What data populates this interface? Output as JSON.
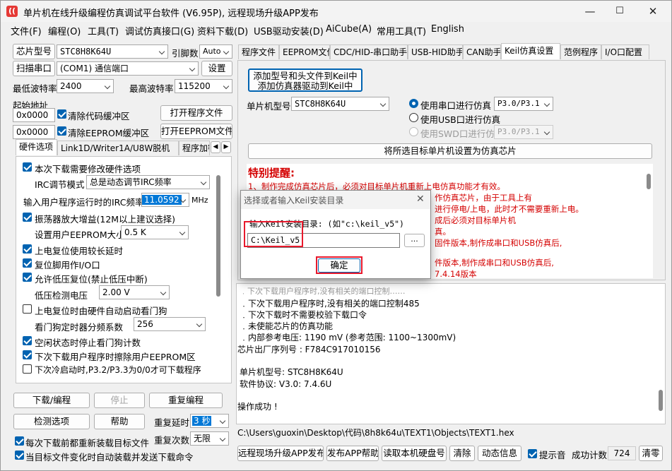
{
  "window": {
    "title": "单片机在线升级编程仿真调试平台软件 (V6.95P), 远程现场升级APP发布",
    "min": "—",
    "max": "☐",
    "close": "✕",
    "app_icon": "signal-icon"
  },
  "menu": [
    "文件(F)",
    "编程(O)",
    "工具(T)",
    "调试仿真接口(G)",
    "资料下载(D)",
    "USB驱动安装(D)",
    "AiCube(A)",
    "常用工具(T)",
    "English"
  ],
  "left": {
    "chip_model_btn": "芯片型号",
    "chip_model": "STC8H8K64U",
    "pin_label": "引脚数",
    "pin_value": "Auto",
    "scan_btn": "扫描串口",
    "port": "(COM1) 通信端口",
    "settings_btn": "设置",
    "min_baud_label": "最低波特率",
    "min_baud": "2400",
    "max_baud_label": "最高波特率",
    "max_baud": "115200",
    "start_addr_label": "起始地址",
    "addr1": "0x0000",
    "clear_code": "清除代码缓冲区",
    "open_prog": "打开程序文件",
    "addr2": "0x0000",
    "clear_eeprom": "清除EEPROM缓冲区",
    "open_eeprom": "打开EEPROM文件",
    "tabs": [
      "硬件选项",
      "Link1D/Writer1A/U8W脱机",
      "程序加密后"
    ],
    "opt_update_hw": "本次下载需要修改硬件选项",
    "irc_mode_label": "IRC调节模式",
    "irc_mode": "总是动态调节IRC频率",
    "irc_freq_label": "输入用户程序运行时的IRC频率",
    "irc_freq": "11.0592",
    "irc_unit": "MHz",
    "osc_gain": "振荡器放大增益(12M以上建议选择)",
    "eeprom_size_label": "设置用户EEPROM大小",
    "eeprom_size": "0.5 K",
    "long_delay": "上电复位使用较长延时",
    "reset_io": "复位脚用作I/O口",
    "lvr": "允许低压复位(禁止低压中断)",
    "lvd_label": "低压检测电压",
    "lvd": "2.00 V",
    "wdt_auto": "上电复位时由硬件自动启动看门狗",
    "wdt_div_label": "看门狗定时器分频系数",
    "wdt_div": "256",
    "idle_wdt": "空闲状态时停止看门狗计数",
    "erase_eeprom": "下次下载用户程序时擦除用户EEPROM区",
    "cold_boot": "下次冷启动时,P3.2/P3.3为0/0才可下载程序",
    "download_btn": "下载/编程",
    "stop_btn": "停止",
    "reprog_btn": "重复编程",
    "check_btn": "检测选项",
    "help_btn": "帮助",
    "repeat_delay_label": "重复延时",
    "repeat_delay": "3 秒",
    "repeat_count_label": "重复次数",
    "repeat_count": "无限",
    "reload_each": "每次下载前都重新装载目标文件",
    "auto_reload": "当目标文件变化时自动装载并发送下载命令"
  },
  "right": {
    "tabs": [
      "程序文件",
      "EEPROM文件",
      "CDC/HID-串口助手",
      "USB-HID助手",
      "CAN助手",
      "Keil仿真设置",
      "范例程序",
      "I/O口配置"
    ],
    "add_keil_btn_l1": "添加型号和头文件到Keil中",
    "add_keil_btn_l2": "添加仿真器驱动到Keil中",
    "mcu_label": "单片机型号",
    "mcu": "STC8H8K64U",
    "r_serial": "使用串口进行仿真",
    "serial_pins": "P3.0/P3.1",
    "r_usb": "使用USB口进行仿真",
    "r_swd": "使用SWD口进行仿真",
    "swd_pins": "P3.0/P3.1",
    "set_chip_btn": "将所选目标单片机设置为仿真芯片",
    "notice_title": "特别提醒:",
    "notice": [
      "1、制作完成仿真芯片后，必须对目标单片机重新上电仿真功能才有效。",
      "作仿真芯片，由于工具上有",
      "进行停电/上电，此时才不需要重新上电。",
      "成后必须对目标单片机",
      "真。",
      "固件版本,制作成串口和USB仿真后,",
      "件版本,制作成串口和USB仿真后,",
      "7.4.14版本"
    ],
    "log": [
      "﹒下次下载用户程序时,没有相关的端口控制485",
      "﹒下次下载时不需要校验下载口令",
      "﹒未使能芯片的仿真功能",
      "﹒内部参考电压: 1190 mV (参考范围: 1100~1300mV)",
      "芯片出厂序列号 : F784C917010156",
      "",
      "  单片机型号: STC8H8K64U",
      "  软件协议: V3.0: 7.4.6U",
      "",
      "操作成功 !"
    ],
    "path": "C:\\Users\\guoxin\\Desktop\\代码\\8h8k64u\\TEXT1\\Objects\\TEXT1.hex",
    "btn_publish": "远程现场升级APP发布",
    "btn_app_help": "发布APP帮助",
    "btn_disk": "读取本机硬盘号",
    "btn_clear": "清除",
    "btn_anim": "动态信息",
    "beep": "提示音",
    "success_label": "成功计数",
    "success_count": "724",
    "btn_clear2": "清零"
  },
  "dialog": {
    "title": "选择或者输入Keil安装目录",
    "close": "✕",
    "prompt": "输入Keil安装目录: (如\"c:\\keil_v5\")",
    "value": "C:\\Keil_v5",
    "browse": "...",
    "ok": "确定"
  },
  "colors": {
    "accent": "#0063b1",
    "notice_red": "#d40000",
    "highlight_red": "#e8192c",
    "selection": "#0078d7"
  }
}
